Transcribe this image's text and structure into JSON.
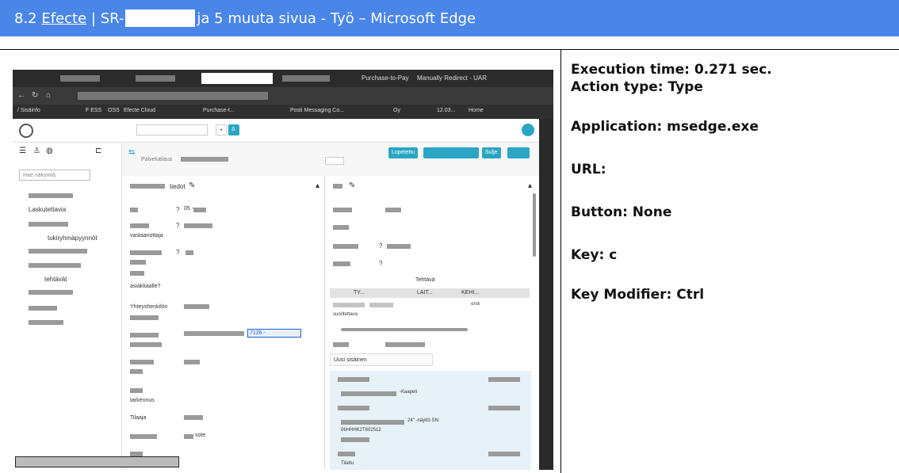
{
  "window": {
    "title_prefix": "8.2",
    "title_link": "Efecte",
    "title_sep": "| SR-",
    "title_suffix": "ja 5 muuta sivua - Työ – Microsoft Edge"
  },
  "info": {
    "execution_time": "Execution time: 0.271 sec.",
    "action_type": "Action type: Type",
    "application": "Application: msedge.exe",
    "url": "URL:",
    "button": "Button: None",
    "key": "Key: c",
    "key_modifier": "Key Modifier: Ctrl"
  },
  "screenshot": {
    "tabs": [
      "Purchase-to-Pay",
      "Manually Redirect - UAR"
    ],
    "favorites": [
      "/ Sisäinfo",
      "F ESS",
      "OSS",
      "Efecte Cloud",
      "Purchase-t...",
      "Posti Messaging Co...",
      "Oy",
      "12.03...",
      "Home"
    ],
    "breadcrumb": "Palvelutilaus",
    "search_placeholder": "Hae näkymiä",
    "left_items": [
      "Laskutettavia",
      "tukiryhmäpyynnöt",
      "tehtävät"
    ],
    "header_buttons": {
      "lopetettu": "Lopetettu",
      "sulje": "Sulje"
    },
    "col1_title": "tiedot",
    "col1_labels": [
      "vastaanottaja",
      "asiakkaalle?",
      "Yhteyshenkilön",
      "tarkennus",
      "Tilaaja"
    ],
    "col1_values": {
      "question1": "?",
      "question2": "?",
      "question3": "?",
      "code": "05 -",
      "sel": "7126 -",
      "sote": "sote"
    },
    "col2_task": "Tehtävä",
    "col2_columns": [
      "TY...",
      "LAIT...",
      "KEHI..."
    ],
    "col2_row_text": "suoritettava",
    "col2_row_val": "orsk",
    "new_internal": "Uusi sisäinen",
    "kaapeli": "-Kaapeli",
    "nayto": "24\" -näyttö SN:",
    "serial": "06HHHK2T602512",
    "tilattu": "Tilattu",
    "small_note": "24\" - 1 kpl"
  }
}
